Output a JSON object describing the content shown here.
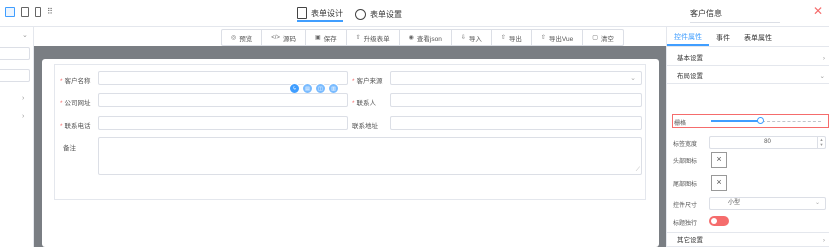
{
  "header": {
    "design_tab": "表单设计",
    "settings_tab": "表单设置",
    "title_value": "客户信息",
    "close_glyph": "✕"
  },
  "toolbar": [
    {
      "icon": "eye-icon",
      "glyph": "◎",
      "label": "预览"
    },
    {
      "icon": "code-icon",
      "glyph": "</>",
      "label": "源码"
    },
    {
      "icon": "save-icon",
      "glyph": "▣",
      "label": "保存"
    },
    {
      "icon": "upgrade-icon",
      "glyph": "⇧",
      "label": "升级表单"
    },
    {
      "icon": "view-json-icon",
      "glyph": "◉",
      "label": "查看json"
    },
    {
      "icon": "import-icon",
      "glyph": "⇩",
      "label": "导入"
    },
    {
      "icon": "export-icon",
      "glyph": "⇧",
      "label": "导出"
    },
    {
      "icon": "export-vue-icon",
      "glyph": "⇧",
      "label": "导出Vue"
    },
    {
      "icon": "clear-icon",
      "glyph": "▢",
      "label": "清空"
    }
  ],
  "form": {
    "customer_name": "客户名称",
    "customer_source": "客户来源",
    "company_url": "公司网址",
    "contact_person": "联系人",
    "contact_phone": "联系电话",
    "contact_address": "联系地址",
    "remark": "备注",
    "required_mark": "*"
  },
  "panel": {
    "tabs": [
      "控件属性",
      "事件",
      "表单属性"
    ],
    "basic_settings": "基本设置",
    "layout_settings": "布局设置",
    "grid_label": "栅格",
    "grid_value": 0.45,
    "label_width_label": "标签宽度",
    "label_width_value": "80",
    "head_icon_label": "头部图标",
    "tail_icon_label": "尾部图标",
    "control_size_label": "控件尺寸",
    "control_size_value": "小型",
    "label_wrap_label": "标题独行",
    "other_settings": "其它设置"
  },
  "colors": {
    "accent": "#409eff",
    "danger": "#f56c6c",
    "canvas_bg": "#7a7e83"
  }
}
